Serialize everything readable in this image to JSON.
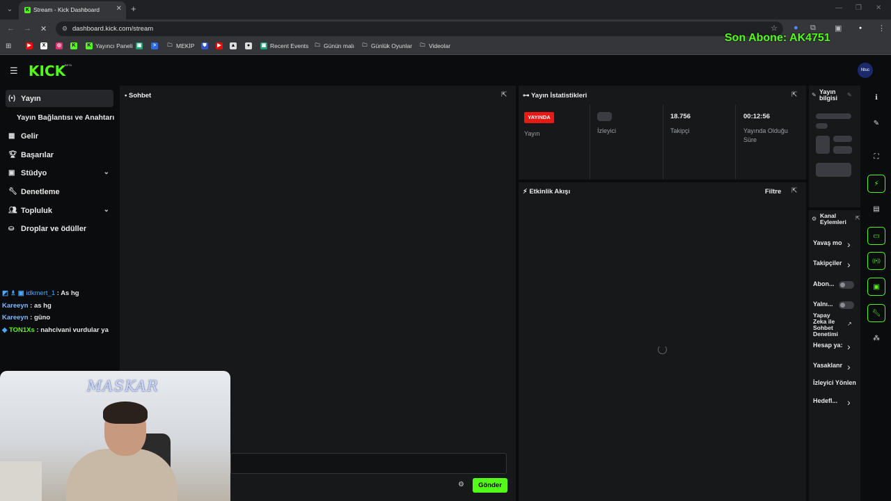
{
  "browser": {
    "tab_title": "Stream - Kick Dashboard",
    "url": "dashboard.kick.com/stream",
    "bookmarks": [
      {
        "label": "",
        "icon": "youtube-icon",
        "color": "#ff0000"
      },
      {
        "label": "",
        "icon": "x-icon",
        "color": "#ffffff"
      },
      {
        "label": "",
        "icon": "instagram-icon",
        "color": "#e1306c"
      },
      {
        "label": "",
        "icon": "kick-icon",
        "color": "#53fc18"
      },
      {
        "label": "Yayıncı Paneli",
        "icon": "kick-icon",
        "color": "#53fc18"
      },
      {
        "label": "",
        "icon": "app-icon",
        "color": "#1fa37a"
      },
      {
        "label": "",
        "icon": "terminal-icon",
        "color": "#2d6cdf"
      },
      {
        "label": "MEKİP",
        "icon": "folder-icon",
        "color": "#cccccc"
      },
      {
        "label": "",
        "icon": "shield-icon",
        "color": "#3155c7"
      },
      {
        "label": "",
        "icon": "youtube-icon",
        "color": "#ff0000"
      },
      {
        "label": "",
        "icon": "image-icon",
        "color": "#dddddd"
      },
      {
        "label": "",
        "icon": "github-icon",
        "color": "#dddddd"
      },
      {
        "label": "Recent Events",
        "icon": "app-icon",
        "color": "#1fa37a"
      },
      {
        "label": "Günün malı",
        "icon": "folder-icon",
        "color": "#cccccc"
      },
      {
        "label": "Günlük Oyunlar",
        "icon": "folder-icon",
        "color": "#cccccc"
      },
      {
        "label": "Videolar",
        "icon": "folder-icon",
        "color": "#cccccc"
      }
    ]
  },
  "overlay": {
    "subscriber_text": "Son Abone: AK4751"
  },
  "header": {
    "logo": "KICK",
    "beta": "BETA",
    "avatar_text": "Ntuc"
  },
  "sidebar": {
    "items": [
      {
        "label": "Yayın",
        "icon": "broadcast-icon"
      },
      {
        "label": "Yayın Bağlantısı ve Anahtarı",
        "icon": ""
      },
      {
        "label": "Gelir",
        "icon": "revenue-icon"
      },
      {
        "label": "Başarılar",
        "icon": "trophy-icon"
      },
      {
        "label": "Stüdyo",
        "icon": "studio-icon"
      },
      {
        "label": "Denetleme",
        "icon": "wrench-icon"
      },
      {
        "label": "Topluluk",
        "icon": "people-icon"
      },
      {
        "label": "Droplar ve ödüller",
        "icon": "gift-icon"
      }
    ]
  },
  "overlay_chat": [
    {
      "user": "idkmert_1",
      "text": " : As hg",
      "color": "#4aa8ff"
    },
    {
      "user": "Kareeyn",
      "text": " : as hg",
      "color": "#7fb8ff"
    },
    {
      "user": "Kareeyn",
      "text": " : güno",
      "color": "#7fb8ff"
    },
    {
      "user": "TON1Xs",
      "text": " : nahcivani vurdular ya",
      "color": "#53fc18"
    }
  ],
  "webcam": {
    "label": "MASKAR"
  },
  "chat_panel": {
    "title": "Sohbet",
    "send_label": "Gönder",
    "input_placeholder": ""
  },
  "stats": {
    "title": "Yayın İstatistikleri",
    "live_badge": "YAYINDA",
    "stream_label": "Yayın",
    "viewers_label": "İzleyici",
    "followers_value": "18.756",
    "followers_label": "Takipçi",
    "duration_value": "00:12:56",
    "duration_label": "Yayında Olduğu Süre"
  },
  "activity": {
    "title": "Etkinlik Akışı",
    "filter_label": "Filtre"
  },
  "stream_info": {
    "title": "Yayın bilgisi"
  },
  "channel_actions": {
    "title": "Kanal Eylemleri",
    "items": [
      {
        "label": "Yavaş mo",
        "control": "chevron"
      },
      {
        "label": "Takipçiler",
        "control": "chevron"
      },
      {
        "label": "Abon...",
        "control": "toggle"
      },
      {
        "label": "Yalnı...",
        "control": "toggle"
      },
      {
        "label": "Yapay Zeka ile Sohbet Denetimi",
        "control": "external"
      },
      {
        "label": "Hesap ya:",
        "control": "chevron"
      },
      {
        "label": "Yasaklanr",
        "control": "chevron"
      },
      {
        "label": "İzleyici Yönlen",
        "control": "none"
      },
      {
        "label": "Hedefl...",
        "control": "chevron"
      }
    ]
  },
  "rail_icons": [
    {
      "icon": "info-icon",
      "active": false
    },
    {
      "icon": "pencil-icon",
      "active": false
    },
    {
      "icon": "focus-icon",
      "active": false
    },
    {
      "icon": "lightning-icon",
      "active": true
    },
    {
      "icon": "document-icon",
      "active": false
    },
    {
      "icon": "chat-icon",
      "active": true
    },
    {
      "icon": "broadcast-icon",
      "active": true
    },
    {
      "icon": "layout-icon",
      "active": true
    },
    {
      "icon": "wrench-icon",
      "active": true
    },
    {
      "icon": "dots-icon",
      "active": false
    }
  ],
  "colors": {
    "brand": "#53fc18",
    "live": "#e91916",
    "panel": "#17181a",
    "background": "#0b0c0d"
  }
}
